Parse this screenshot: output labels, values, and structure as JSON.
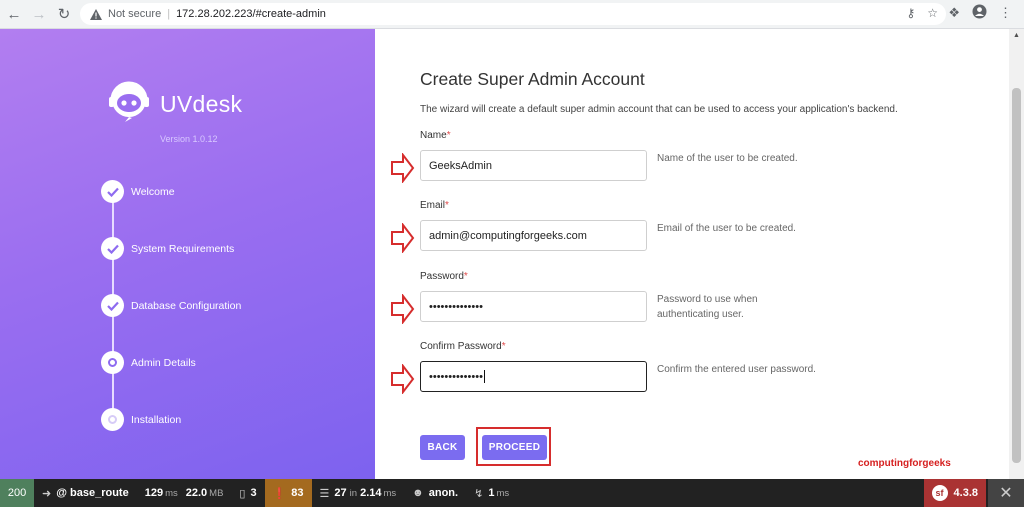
{
  "browser": {
    "security_label": "Not secure",
    "url": "172.28.202.223/#create-admin"
  },
  "sidebar": {
    "brand": "UVdesk",
    "version": "Version 1.0.12",
    "steps": [
      {
        "label": "Welcome",
        "state": "done"
      },
      {
        "label": "System Requirements",
        "state": "done"
      },
      {
        "label": "Database Configuration",
        "state": "done"
      },
      {
        "label": "Admin Details",
        "state": "current"
      },
      {
        "label": "Installation",
        "state": "pending"
      }
    ]
  },
  "form": {
    "title": "Create Super Admin Account",
    "description": "The wizard will create a default super admin account that can be used to access your application's backend.",
    "fields": [
      {
        "label": "Name",
        "value": "GeeksAdmin",
        "hint": "Name of the user to be created."
      },
      {
        "label": "Email",
        "value": "admin@computingforgeeks.com",
        "hint": "Email of the user to be created."
      },
      {
        "label": "Password",
        "value": "••••••••••••••",
        "hint": "Password to use when authenticating user."
      },
      {
        "label": "Confirm Password",
        "value": "••••••••••••••",
        "hint": "Confirm the entered user password."
      }
    ],
    "required_mark": "*",
    "back_label": "BACK",
    "proceed_label": "PROCEED",
    "watermark": "computingforgeeks"
  },
  "toolbar": {
    "status": "200",
    "route": "@ base_route",
    "time_value": "129",
    "time_unit": "ms",
    "memory_value": "22.0",
    "memory_unit": "MB",
    "forms_count": "3",
    "warnings_count": "83",
    "db_queries": "27",
    "db_in": "in",
    "db_time": "2.14",
    "db_unit": "ms",
    "user": "anon.",
    "ajax_value": "1",
    "ajax_unit": "ms",
    "sf_version": "4.3.8"
  },
  "colors": {
    "accent": "#7b6cf0",
    "highlight": "#d62d2d"
  }
}
